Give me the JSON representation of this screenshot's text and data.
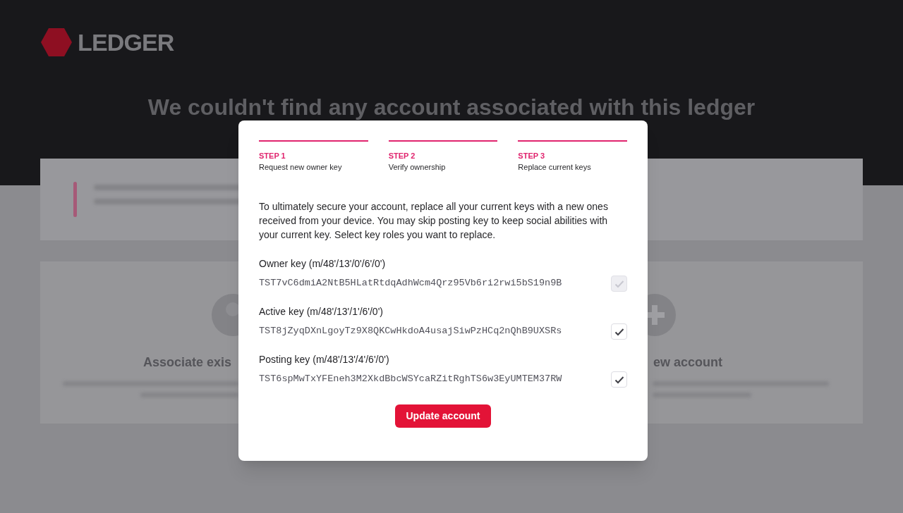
{
  "background": {
    "logo": "LEDGER",
    "heading": "We couldn't find any account associated with this ledger",
    "cards": [
      {
        "title": "Associate exis"
      },
      {
        "title": "ew account"
      }
    ]
  },
  "modal": {
    "steps": [
      {
        "label": "STEP 1",
        "description": "Request new owner key",
        "active": true
      },
      {
        "label": "STEP 2",
        "description": "Verify ownership",
        "active": true
      },
      {
        "label": "STEP 3",
        "description": "Replace current keys",
        "active": true
      }
    ],
    "intro": "To ultimately secure your account, replace all your current keys with a new ones received from your device. You may skip posting key to keep social abilities with your current key. Select key roles you want to replace.",
    "keys": [
      {
        "label": "Owner key (m/48'/13'/0'/6'/0')",
        "value": "TST7vC6dmiA2NtB5HLatRtdqAdhWcm4Qrz95Vb6ri2rwi5bS19n9B",
        "checked": true,
        "disabled": true
      },
      {
        "label": "Active key (m/48'/13'/1'/6'/0')",
        "value": "TST8jZyqDXnLgoyTz9X8QKCwHkdoA4usajSiwPzHCq2nQhB9UXSRs",
        "checked": true,
        "disabled": false
      },
      {
        "label": "Posting key (m/48'/13'/4'/6'/0')",
        "value": "TST6spMwTxYFEneh3M2XkdBbcWSYcaRZitRghTS6w3EyUMTEM37RW",
        "checked": true,
        "disabled": false
      }
    ],
    "button": "Update account"
  }
}
